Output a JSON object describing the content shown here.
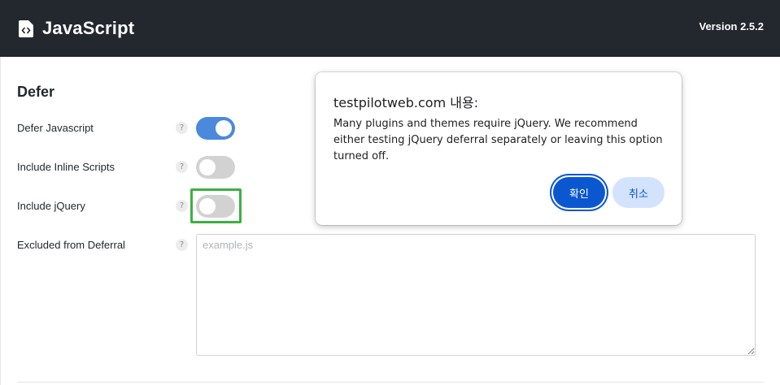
{
  "header": {
    "title": "JavaScript",
    "version": "Version 2.5.2",
    "logo_icon": "file-code-icon"
  },
  "section": {
    "title": "Defer"
  },
  "options": [
    {
      "label": "Defer Javascript",
      "help": "?",
      "enabled": true
    },
    {
      "label": "Include Inline Scripts",
      "help": "?",
      "enabled": false
    },
    {
      "label": "Include jQuery",
      "help": "?",
      "enabled": false
    }
  ],
  "excluded": {
    "label": "Excluded from Deferral",
    "help": "?",
    "placeholder": "example.js",
    "value": ""
  },
  "dialog": {
    "title": "testpilotweb.com 내용:",
    "message": "Many plugins and themes require jQuery. We recommend either testing jQuery deferral separately or leaving this option turned off.",
    "ok_label": "확인",
    "cancel_label": "취소"
  },
  "colors": {
    "header_bg": "#23272e",
    "toggle_on": "#4a89dc",
    "toggle_off": "#d2d2d2",
    "highlight": "#3cb043",
    "dialog_primary": "#0b57d0",
    "dialog_secondary": "#d3e3fd"
  }
}
